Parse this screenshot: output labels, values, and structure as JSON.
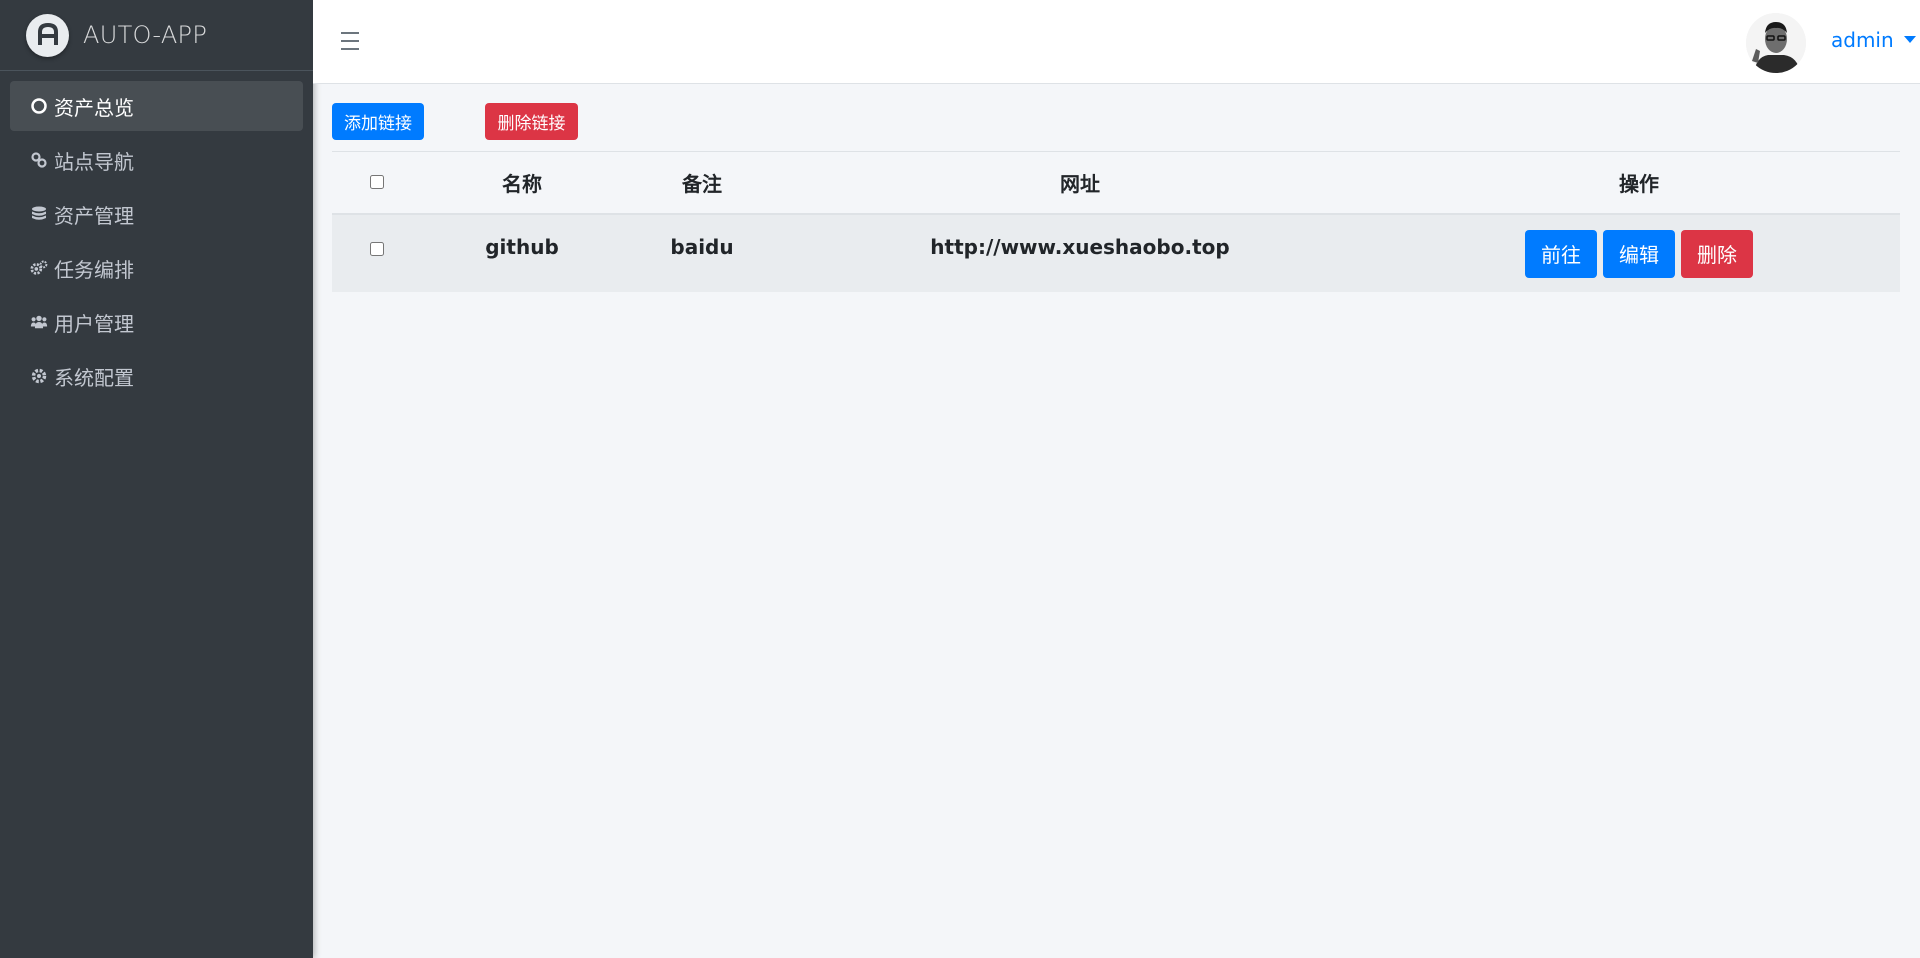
{
  "brand": {
    "name": "AUTO-APP"
  },
  "sidebar": {
    "items": [
      {
        "label": "资产总览",
        "icon": "circle-icon",
        "active": true
      },
      {
        "label": "站点导航",
        "icon": "link-icon",
        "active": false
      },
      {
        "label": "资产管理",
        "icon": "database-icon",
        "active": false
      },
      {
        "label": "任务编排",
        "icon": "cogs-icon",
        "active": false
      },
      {
        "label": "用户管理",
        "icon": "users-icon",
        "active": false
      },
      {
        "label": "系统配置",
        "icon": "gear-icon",
        "active": false
      }
    ]
  },
  "header": {
    "username": "admin",
    "menu_icon": "hamburger-icon",
    "avatar_icon": "user-avatar"
  },
  "toolbar": {
    "add_label": "添加链接",
    "delete_label": "删除链接"
  },
  "table": {
    "columns": {
      "name": "名称",
      "remark": "备注",
      "url": "网址",
      "ops": "操作"
    },
    "rows": [
      {
        "name": "github",
        "remark": "baidu",
        "url": "http://www.xueshaobo.top",
        "go_label": "前往",
        "edit_label": "编辑",
        "delete_label": "删除"
      }
    ]
  },
  "colors": {
    "sidebar": "#343a40",
    "primary": "#007bff",
    "danger": "#dc3545",
    "background": "#f4f6f9"
  }
}
